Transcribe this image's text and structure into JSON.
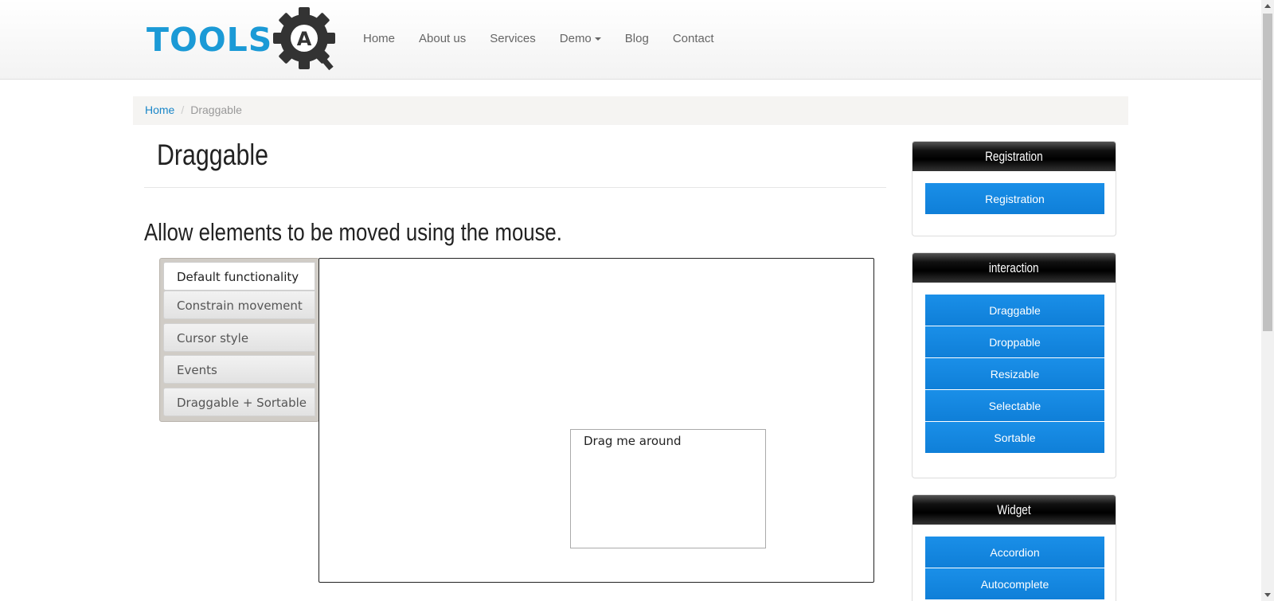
{
  "logo": {
    "text": "TOOLS",
    "badge_letter": "A",
    "icon": "gear-logo-icon"
  },
  "nav": {
    "items": [
      {
        "label": "Home"
      },
      {
        "label": "About us"
      },
      {
        "label": "Services"
      },
      {
        "label": "Demo"
      },
      {
        "label": "Blog"
      },
      {
        "label": "Contact"
      }
    ],
    "dropdown_icon": "caret-down-icon"
  },
  "breadcrumb": {
    "home": "Home",
    "separator": "/",
    "current": "Draggable"
  },
  "page": {
    "title": "Draggable",
    "subtitle": "Allow elements to be moved using the mouse."
  },
  "tabs": [
    {
      "label": "Default functionality",
      "active": true
    },
    {
      "label": "Constrain movement",
      "active": false
    },
    {
      "label": "Cursor style",
      "active": false
    },
    {
      "label": "Events",
      "active": false
    },
    {
      "label": "Draggable + Sortable",
      "active": false
    }
  ],
  "demo": {
    "draggable_text": "Drag me around"
  },
  "sidebar": {
    "registration": {
      "title": "Registration",
      "buttons": [
        "Registration"
      ]
    },
    "interaction": {
      "title": "interaction",
      "buttons": [
        "Draggable",
        "Droppable",
        "Resizable",
        "Selectable",
        "Sortable"
      ]
    },
    "widget": {
      "title": "Widget",
      "buttons": [
        "Accordion",
        "Autocomplete"
      ]
    }
  },
  "colors": {
    "brand": "#1b9ad6",
    "button": "#1a8fe8",
    "link": "#1a86c8"
  }
}
